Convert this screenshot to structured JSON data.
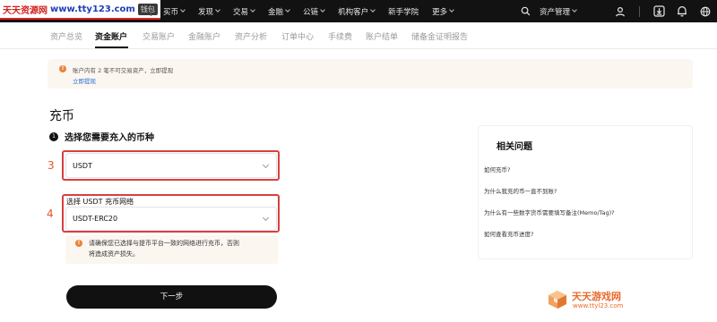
{
  "watermark": {
    "site_name": "天天资源网",
    "url": "www.tty123.com",
    "suffix": "钱包"
  },
  "topnav": {
    "items": [
      {
        "label": "买币",
        "caret": true
      },
      {
        "label": "发现",
        "caret": true
      },
      {
        "label": "交易",
        "caret": true
      },
      {
        "label": "金融",
        "caret": true
      },
      {
        "label": "公链",
        "caret": true
      },
      {
        "label": "机构客户",
        "caret": true
      },
      {
        "label": "新手学院",
        "caret": false
      },
      {
        "label": "更多",
        "caret": true
      }
    ],
    "asset_mgmt_label": "资产管理",
    "icons": [
      "search-icon",
      "user-icon",
      "download-icon",
      "bell-icon",
      "globe-icon"
    ]
  },
  "subnav": {
    "tabs": [
      {
        "label": "资产总览",
        "active": false
      },
      {
        "label": "资金账户",
        "active": true
      },
      {
        "label": "交易账户",
        "active": false
      },
      {
        "label": "金融账户",
        "active": false
      },
      {
        "label": "资产分析",
        "active": false
      },
      {
        "label": "订单中心",
        "active": false
      },
      {
        "label": "手续费",
        "active": false
      },
      {
        "label": "账户结单",
        "active": false
      },
      {
        "label": "储备金证明报告",
        "active": false
      }
    ]
  },
  "notice": {
    "icon_glyph": "!",
    "text": "账户内有 2 笔不可交易资产，立即提现",
    "link": "立即提现"
  },
  "page": {
    "title": "充币",
    "step1": {
      "number": "1",
      "label": "选择您需要充入的币种"
    },
    "annotations": {
      "coin": "3",
      "network": "4"
    },
    "coin_select": {
      "value": "USDT"
    },
    "network": {
      "label": "选择 USDT 充币网络",
      "value": "USDT-ERC20",
      "warning_line1": "请确保您已选择与提币平台一致的网络进行充币，否则",
      "warning_line2": "将造成资产损失。"
    },
    "next_button": "下一步"
  },
  "faq": {
    "title": "相关问题",
    "items": [
      "如何充币?",
      "为什么我充的币一直不到账?",
      "为什么有一些数字货币需要填写备注(Memo/Tag)?",
      "如何查看充币进度?"
    ]
  },
  "brand": {
    "name": "天天游戏网",
    "url": "www.ttyl23.com"
  },
  "colors": {
    "nav_bg": "#121212",
    "highlight": "#d84040",
    "annotation": "#e4552b",
    "warning": "#e9833a",
    "link": "#2a6fd6",
    "notice_bg": "#fcf6f1",
    "button_bg": "#111111"
  }
}
